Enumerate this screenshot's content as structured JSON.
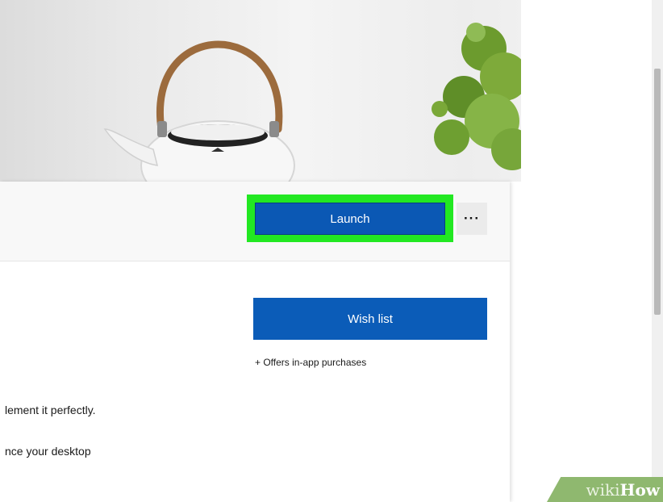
{
  "store_page": {
    "launch_label": "Launch",
    "more_label": "···",
    "wish_list_label": "Wish list",
    "offers_text": "+ Offers in-app purchases",
    "description_line_1": "lement it perfectly.",
    "description_line_2": "nce your desktop"
  },
  "watermark": {
    "prefix": "wiki",
    "suffix": "How"
  },
  "colors": {
    "accent_blue": "#0b58b4",
    "highlight_green": "#22e822",
    "watermark_green": "#8fb86f"
  },
  "icons": {
    "hero": "teapot-plant-hero-image",
    "more": "more-options-icon"
  }
}
